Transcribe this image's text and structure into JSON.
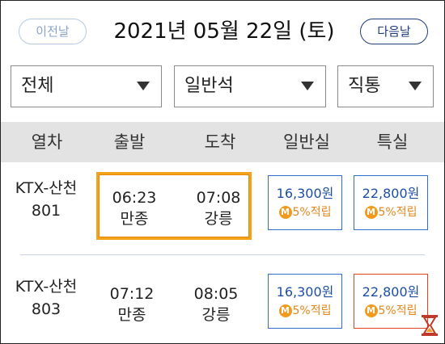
{
  "header": {
    "prev_label": "이전날",
    "date": "2021년 05월 22일 (토)",
    "next_label": "다음날"
  },
  "filters": {
    "train_type": "전체",
    "seat_type": "일반석",
    "route_type": "직통"
  },
  "columns": [
    "열차",
    "출발",
    "도착",
    "일반실",
    "특실"
  ],
  "trains": [
    {
      "name": "KTX-산천",
      "number": "801",
      "dep_time": "06:23",
      "dep_station": "만종",
      "arr_time": "07:08",
      "arr_station": "강릉",
      "general_price": "16,300원",
      "special_price": "22,800원",
      "mileage": "5%적립"
    },
    {
      "name": "KTX-산천",
      "number": "803",
      "dep_time": "07:12",
      "dep_station": "만종",
      "arr_time": "08:05",
      "arr_station": "강릉",
      "general_price": "16,300원",
      "special_price": "22,800원",
      "mileage": "5%적립"
    }
  ],
  "badge_letter": "M",
  "icons": {
    "dropdown": "caret-down-icon",
    "loading": "hourglass-icon",
    "mileage": "mileage-badge-icon"
  },
  "colors": {
    "accent_navy": "#1f3c7a",
    "fare_blue": "#2f6ec9",
    "mileage_orange": "#f39a1e",
    "highlight": "#f5a21b",
    "selected_red": "#e2421d"
  }
}
